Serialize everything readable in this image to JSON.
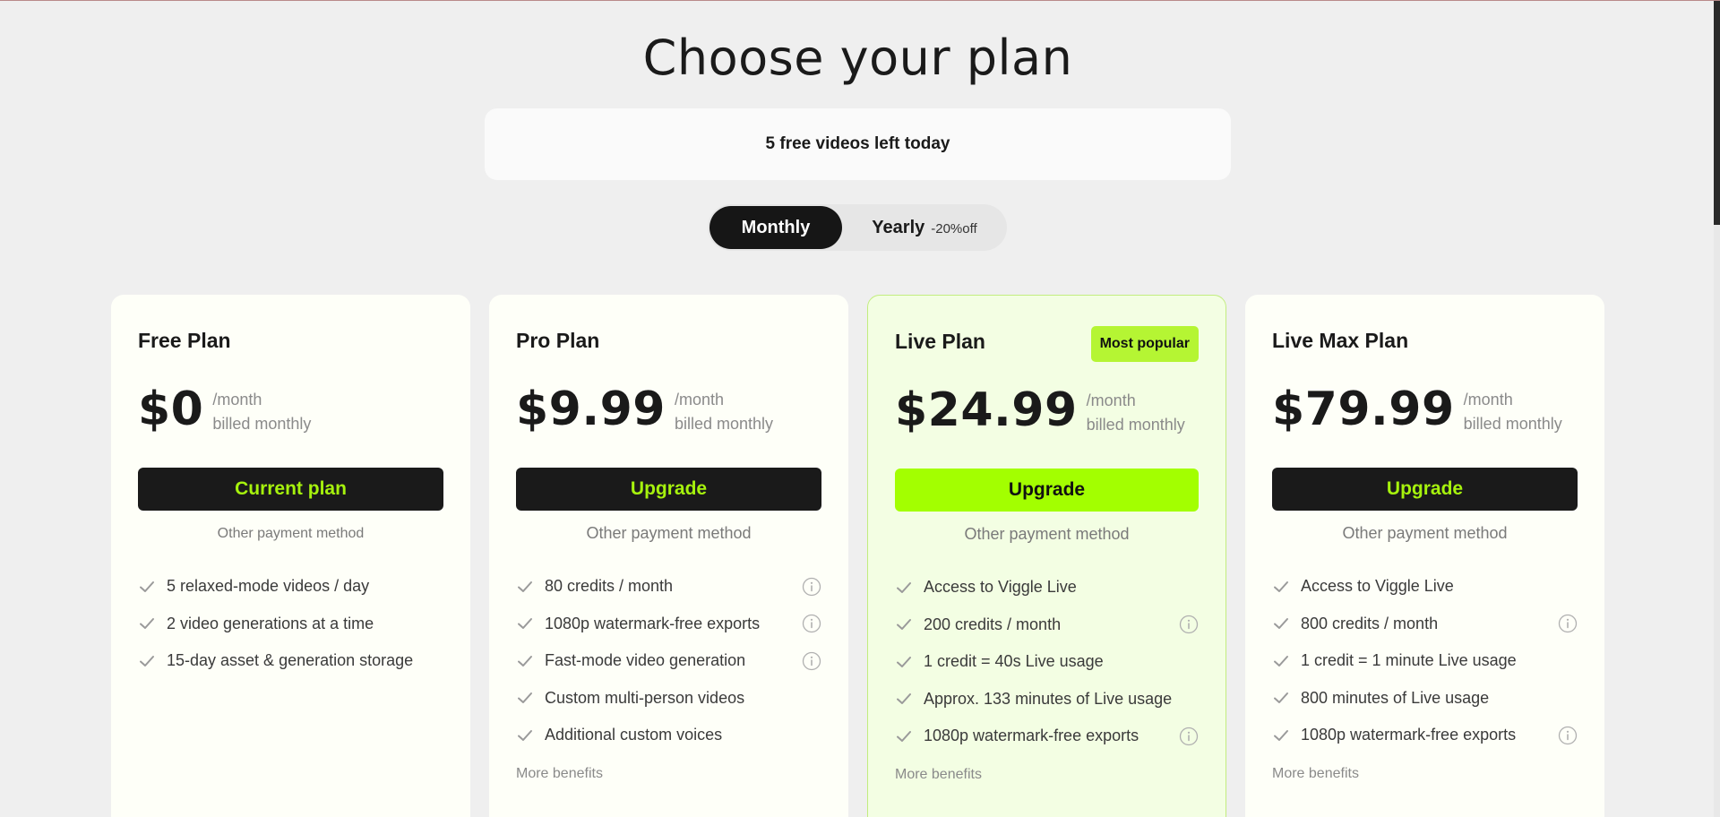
{
  "page": {
    "title": "Choose your plan"
  },
  "quota": {
    "text": "5 free videos left today"
  },
  "billing_toggle": {
    "monthly": "Monthly",
    "yearly": "Yearly",
    "yearly_discount": "-20%off",
    "selected": "Monthly"
  },
  "colors": {
    "accent": "#a3ff00",
    "accent_text": "#a6f20d",
    "badge": "#b5f533",
    "dark": "#1a1a1a"
  },
  "plans": [
    {
      "name": "Free Plan",
      "price": "$0",
      "period": "/month",
      "billing": "billed monthly",
      "button": "Current plan",
      "other_payment": "Other payment method",
      "features": [
        {
          "text": "5 relaxed-mode videos / day",
          "info": false
        },
        {
          "text": "2 video generations at a time",
          "info": false
        },
        {
          "text": "15-day asset & generation storage",
          "info": false
        }
      ]
    },
    {
      "name": "Pro Plan",
      "price": "$9.99",
      "period": "/month",
      "billing": "billed monthly",
      "button": "Upgrade",
      "other_payment": "Other payment method",
      "more": "More benefits",
      "features": [
        {
          "text": "80 credits / month",
          "info": true
        },
        {
          "text": "1080p watermark-free exports",
          "info": true
        },
        {
          "text": "Fast-mode video generation",
          "info": true
        },
        {
          "text": "Custom multi-person videos",
          "info": false
        },
        {
          "text": "Additional custom voices",
          "info": false
        }
      ]
    },
    {
      "name": "Live Plan",
      "badge": "Most popular",
      "price": "$24.99",
      "period": "/month",
      "billing": "billed monthly",
      "button": "Upgrade",
      "other_payment": "Other payment method",
      "more": "More benefits",
      "features": [
        {
          "text": "Access to Viggle Live",
          "info": false
        },
        {
          "text": "200 credits / month",
          "info": true
        },
        {
          "text": "1 credit = 40s Live usage",
          "info": false
        },
        {
          "text": "Approx. 133 minutes of Live usage",
          "info": false
        },
        {
          "text": "1080p watermark-free exports",
          "info": true
        }
      ]
    },
    {
      "name": "Live Max Plan",
      "price": "$79.99",
      "period": "/month",
      "billing": "billed monthly",
      "button": "Upgrade",
      "other_payment": "Other payment method",
      "more": "More benefits",
      "features": [
        {
          "text": "Access to Viggle Live",
          "info": false
        },
        {
          "text": "800 credits / month",
          "info": true
        },
        {
          "text": "1 credit = 1 minute Live usage",
          "info": false
        },
        {
          "text": "800 minutes of Live usage",
          "info": false
        },
        {
          "text": "1080p watermark-free exports",
          "info": true
        }
      ]
    }
  ]
}
